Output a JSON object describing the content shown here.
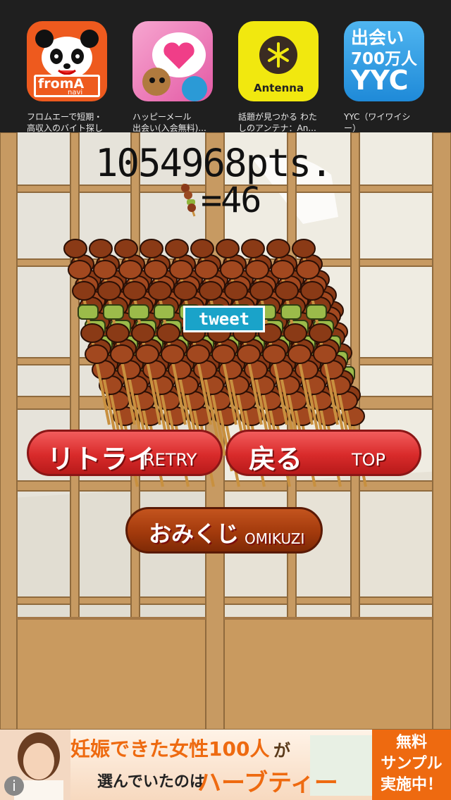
{
  "ad_bar": {
    "apps": [
      {
        "name": "fromA-navi-icon",
        "caption_line1": "フロムエーで短期・",
        "caption_line2": "高収入のバイト探し",
        "icon_text_top": "fromA",
        "icon_text_bottom": "navi"
      },
      {
        "name": "happy-mail-icon",
        "caption_line1": "ハッピーメール",
        "caption_line2": "出会い(入会無料)...",
        "icon_text_top": "",
        "icon_text_bottom": ""
      },
      {
        "name": "antenna-icon",
        "caption_line1": "話題が見つかる わた",
        "caption_line2": "しのアンテナ：An...",
        "icon_text_top": "",
        "icon_text_bottom": "Antenna"
      },
      {
        "name": "yyc-icon",
        "caption_line1": "YYC（ワイワイシ",
        "caption_line2": "ー）",
        "icon_text_top": "出会い",
        "icon_text_mid": "700万人",
        "icon_text_bottom": "YYC"
      }
    ]
  },
  "game": {
    "score": "1054968pts.",
    "skewer_count": "=46",
    "tweet_label": "tweet",
    "retry_jp": "リトライ",
    "retry_en": "RETRY",
    "top_jp": "戻る",
    "top_en": "TOP",
    "omikuji_jp": "おみくじ",
    "omikuji_en": "OMIKUZI"
  },
  "banner": {
    "headline_part1": "妊娠できた女性100人",
    "headline_part2": "が",
    "subline_part1": "選んでいたのは",
    "subline_part2": "ハーブティー",
    "cta_line1": "無料",
    "cta_line2": "サンプル",
    "cta_line3": "実施中！",
    "info_icon": "info-icon"
  },
  "colors": {
    "button_red": "#d92b2b",
    "button_brown": "#a33a0c",
    "tweet_blue": "#1aa3c9",
    "wood": "#c79a62"
  }
}
